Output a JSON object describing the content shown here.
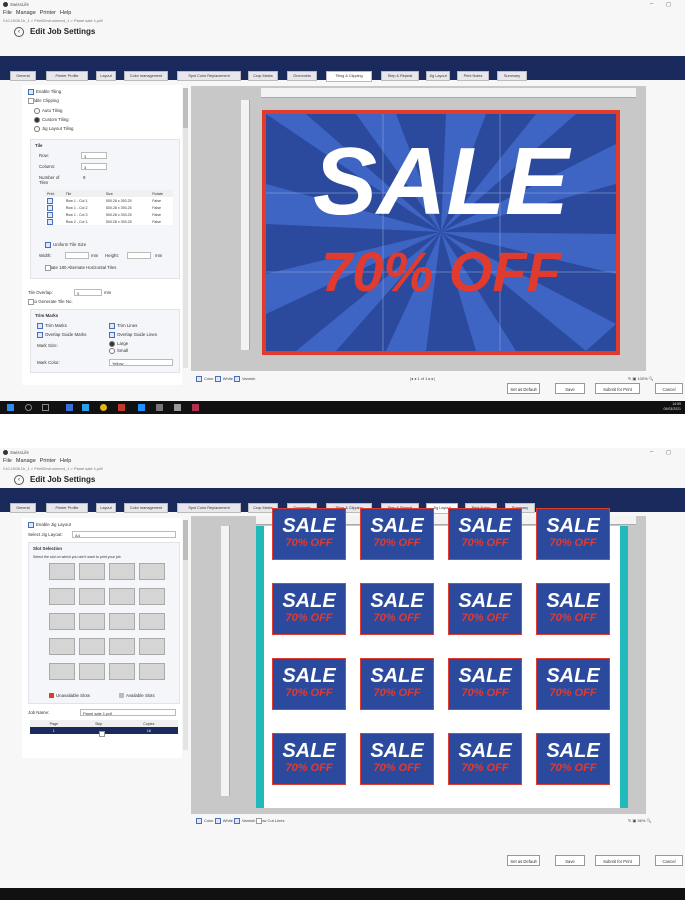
{
  "app": {
    "title": "SwissLife",
    "menu": [
      "File",
      "Manage",
      "Printer",
      "Help"
    ],
    "breadcrumb": "\\\\10.1008.1h_1 > PrintEnvironment_1 > Panel sale 1.pdf",
    "page_title": "Edit Job Settings",
    "win_min": "–",
    "win_max": "◻"
  },
  "tabs": [
    "General",
    "Printer Profile",
    "Layout",
    "Color management",
    "Spot Color Replacement",
    "Crop Marks",
    "Grommets",
    "Tiling & Clipping",
    "Step & Repeat",
    "Jig Layout",
    "Print Notes",
    "Summary"
  ],
  "s1": {
    "active_tab": "Tiling & Clipping",
    "enable_tiling": "Enable Tiling",
    "enable_clipping": "Enable Clipping",
    "auto_tiling": "Auto Tiling",
    "custom_tiling": "Custom Tiling",
    "jig_layout_tiling": "Jig Layout Tiling",
    "tile_group": "Tile",
    "row_label": "Row:",
    "row_value": "3",
    "column_label": "Column:",
    "column_value": "3",
    "number_of_tiles_label": "Number of Tiles",
    "number_of_tiles_value": "9",
    "table_headers": [
      "Print",
      "Tile",
      "Size",
      "Rotate"
    ],
    "table_rows": [
      [
        "Row 1 - Col 1",
        "500.28 x 393.25",
        "False"
      ],
      [
        "Row 1 - Col 2",
        "500.28 x 393.25",
        "False"
      ],
      [
        "Row 1 - Col 3",
        "500.28 x 393.25",
        "False"
      ],
      [
        "Row 2 - Col 1",
        "500.28 x 393.25",
        "False"
      ]
    ],
    "uniform_tile_size": "Uniform Tile Size",
    "width_label": "Width:",
    "height_label": "Height:",
    "unit_mm": "mm",
    "rotate_alt": "Rotate 180 Alternate Horizontal Tiles",
    "tile_overlap_label": "Tile Overlap:",
    "tile_overlap_value": "0",
    "auto_generate": "Auto Generate Tile No.",
    "trim_marks_group": "Trim Marks",
    "trim_marks": "Trim Marks",
    "trim_lines": "Trim Lines",
    "overlap_guide_marks": "Overlap Guide Marks",
    "overlap_guide_lines": "Overlap Guide Lines",
    "mark_size_label": "Mark Size:",
    "large": "Large",
    "small": "Small",
    "mark_color_label": "Mark Color:",
    "mark_color_value": "Yellow",
    "footer_checks": [
      "Color",
      "White",
      "Varnish"
    ],
    "pager": "1 of 1",
    "zoom": "100%"
  },
  "s2": {
    "active_tab": "Jig Layout",
    "enable_jig": "Enable Jig Layout",
    "select_jig_label": "Select Jig Layout:",
    "select_jig_value": "A4",
    "slot_selection": "Slot Selection",
    "slot_hint": "Select the slot on which you don't want to print your job",
    "unavailable_slots": "Unavailable Slots",
    "available_slots": "Available Slots",
    "job_name_label": "Job Name:",
    "job_name_value": "Panel sale 1.pdf",
    "page_headers": [
      "Page",
      "Skip",
      "Copies"
    ],
    "page_row": [
      "1",
      "",
      "16"
    ],
    "footer_checks": [
      "Color",
      "White",
      "Varnish",
      "Show Cut Lines"
    ],
    "zoom": "36%"
  },
  "poster": {
    "line1": "SALE",
    "line2": "70% OFF"
  },
  "buttons": {
    "set_default": "Set as Default",
    "save": "Save",
    "submit": "Submit for Print",
    "cancel": "Cancel"
  },
  "clock": {
    "time": "14:59",
    "date": "09/03/2021"
  },
  "colors": {
    "navy": "#1a2a5c",
    "poster_blue": "#2b4a9e",
    "sale_red": "#e03b2e",
    "teal": "#21b9b9"
  }
}
